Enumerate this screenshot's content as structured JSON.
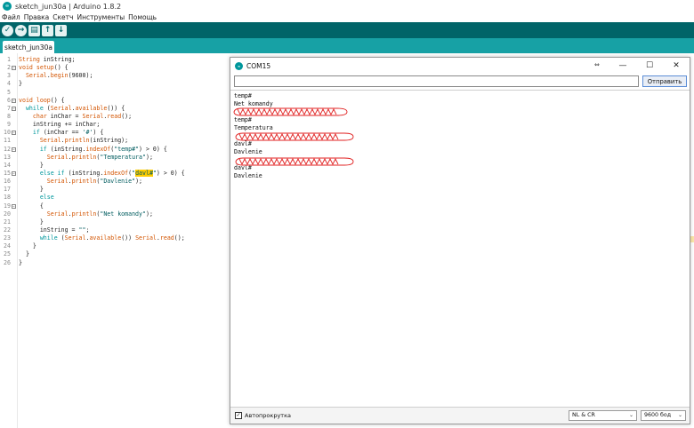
{
  "window": {
    "title": "sketch_jun30a | Arduino 1.8.2",
    "logo_text": "∞"
  },
  "menu": [
    "Файл",
    "Правка",
    "Скетч",
    "Инструменты",
    "Помощь"
  ],
  "toolbar": {
    "verify": "✓",
    "upload": "→",
    "new": "▤",
    "open": "↑",
    "save": "↓"
  },
  "tab": {
    "label": "sketch_jun30a"
  },
  "code": {
    "line_numbers": [
      "1",
      "2",
      "3",
      "4",
      "5",
      "6",
      "7",
      "8",
      "9",
      "10",
      "11",
      "12",
      "13",
      "14",
      "15",
      "16",
      "17",
      "18",
      "19",
      "20",
      "21",
      "22",
      "23",
      "24",
      "25",
      "26"
    ],
    "fold_symbol": "−"
  },
  "serial": {
    "title": "COM15",
    "logo_text": "∞",
    "resize_symbol": "⇔",
    "minimize": "—",
    "maximize": "☐",
    "close": "✕",
    "input_value": "",
    "send_label": "Отправить",
    "output_lines": [
      "temp#",
      "Net komandy",
      "",
      "temp#",
      "Temperatura",
      "",
      "davl#",
      "Davlenie",
      "",
      "davl#",
      "Davlenie"
    ],
    "autoscroll_checked": "✓",
    "autoscroll_label": "Автопрокрутка",
    "line_ending": "NL & CR",
    "baud": "9600 бод",
    "dropdown_arrow": "⌄",
    "accent": "#00979c",
    "scribble_color": "#e02020"
  }
}
